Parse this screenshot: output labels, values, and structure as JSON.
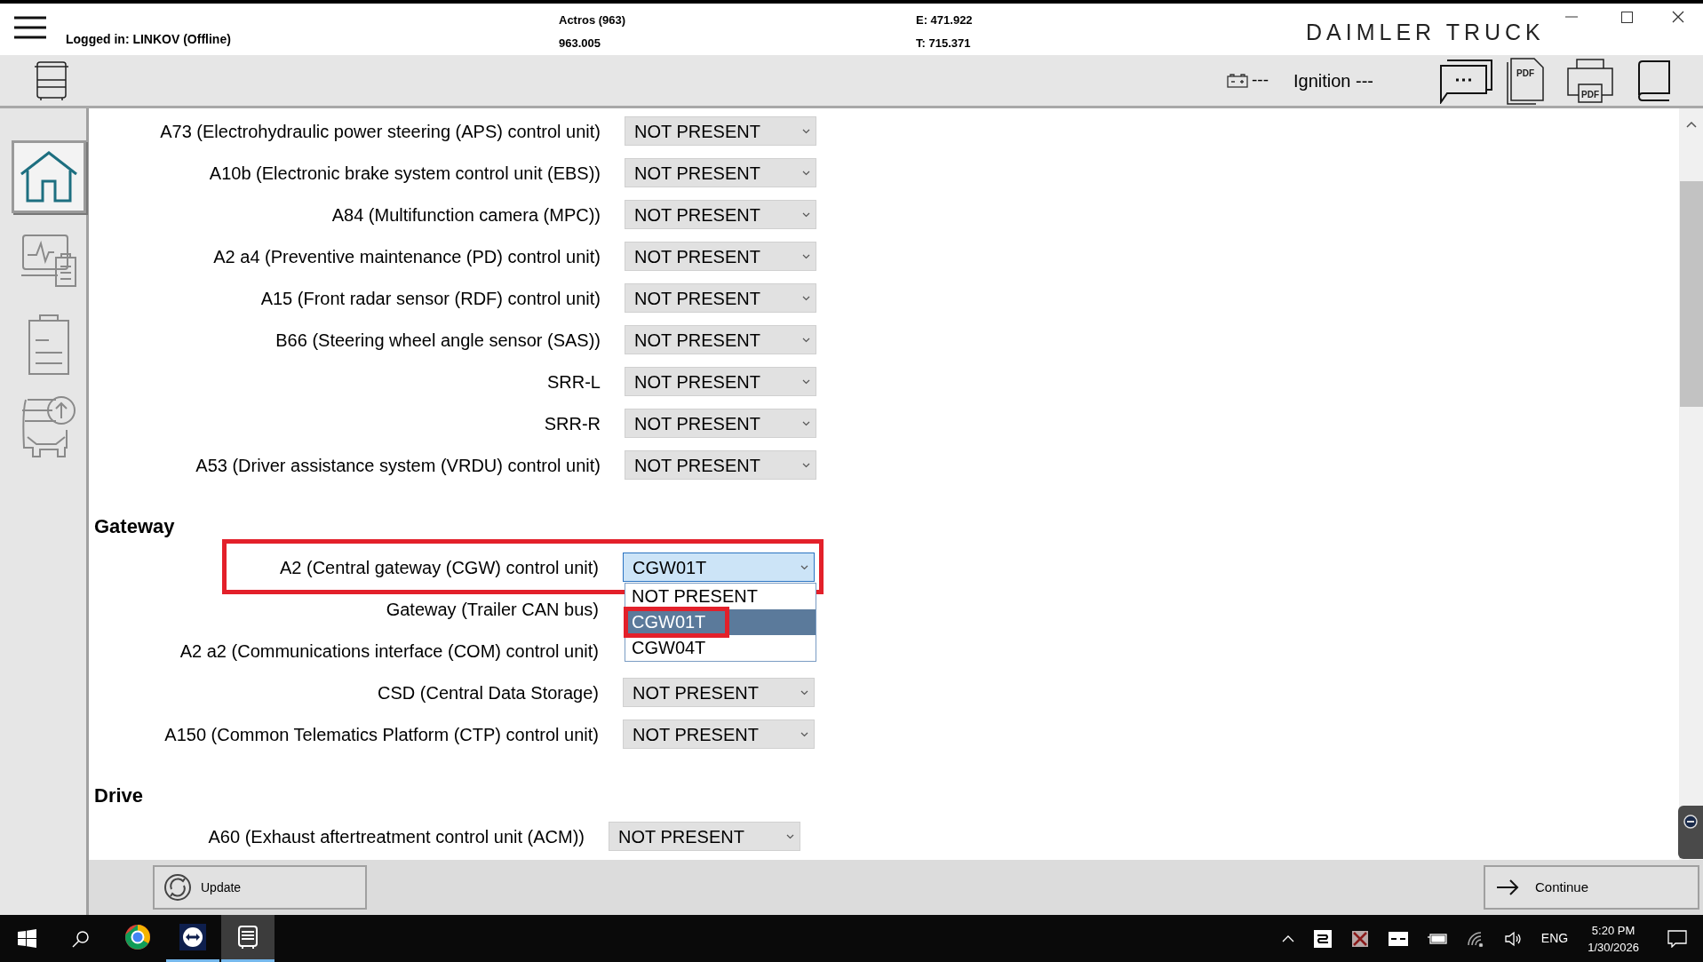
{
  "header": {
    "login": "Logged in: LINKOV (Offline)",
    "vehicle_model": "Actros (963)",
    "vehicle_code": "963.005",
    "e_number": "E: 471.922",
    "t_number": "T: 715.371",
    "brand": "DAIMLER TRUCK"
  },
  "toolbar": {
    "battery_status": "---",
    "ignition": "Ignition ---",
    "pdf_icon_label": "PDF",
    "print_icon_label": "PDF"
  },
  "sidebar": {
    "items": [
      {
        "kind": "home",
        "selected": true
      },
      {
        "kind": "diagnosis",
        "selected": false
      },
      {
        "kind": "checklist",
        "selected": false
      },
      {
        "kind": "truck-update",
        "selected": false
      }
    ]
  },
  "sections": [
    {
      "rows": [
        {
          "label": "A73 (Electrohydraulic power steering (APS) control unit)",
          "value": "NOT PRESENT",
          "highlighted": false
        },
        {
          "label": "A10b (Electronic brake system control unit (EBS))",
          "value": "NOT PRESENT",
          "highlighted": false
        },
        {
          "label": "A84 (Multifunction camera (MPC))",
          "value": "NOT PRESENT",
          "highlighted": false
        },
        {
          "label": "A2 a4 (Preventive maintenance (PD) control unit)",
          "value": "NOT PRESENT",
          "highlighted": false
        },
        {
          "label": "A15 (Front radar sensor (RDF) control unit)",
          "value": "NOT PRESENT",
          "highlighted": false
        },
        {
          "label": "B66 (Steering wheel angle sensor (SAS))",
          "value": "NOT PRESENT",
          "highlighted": false
        },
        {
          "label": "SRR-L",
          "value": "NOT PRESENT",
          "highlighted": false
        },
        {
          "label": "SRR-R",
          "value": "NOT PRESENT",
          "highlighted": false
        },
        {
          "label": "A53 (Driver assistance system (VRDU) control unit)",
          "value": "NOT PRESENT",
          "highlighted": false
        }
      ]
    },
    {
      "title": "Gateway",
      "rows": [
        {
          "label": "A2 (Central gateway (CGW) control unit)",
          "value": "CGW01T",
          "highlighted": true,
          "expanded": true,
          "options": [
            {
              "label": "NOT PRESENT",
              "selected": false,
              "highlighted": false
            },
            {
              "label": "CGW01T",
              "selected": true,
              "highlighted": true
            },
            {
              "label": "CGW04T",
              "selected": false,
              "highlighted": false
            }
          ]
        },
        {
          "label": "Gateway (Trailer CAN bus)",
          "highlighted": false
        },
        {
          "label": "A2 a2 (Communications interface (COM) control unit)",
          "highlighted": false
        },
        {
          "label": "CSD (Central Data Storage)",
          "value": "NOT PRESENT",
          "highlighted": false
        },
        {
          "label": "A150 (Common Telematics Platform (CTP) control unit)",
          "value": "NOT PRESENT",
          "highlighted": false
        }
      ]
    },
    {
      "title": "Drive",
      "rows": [
        {
          "label": "A60 (Exhaust aftertreatment control unit (ACM))",
          "value": "NOT PRESENT",
          "highlighted": false
        }
      ]
    }
  ],
  "buttons": {
    "update": "Update",
    "continue": "Continue"
  },
  "taskbar": {
    "apps": [
      {
        "kind": "chrome",
        "running": false,
        "active": false
      },
      {
        "kind": "teamviewer",
        "running": true,
        "active": false
      },
      {
        "kind": "diagnosis-app",
        "running": true,
        "active": true
      }
    ],
    "language": "ENG",
    "time": "5:20 PM",
    "date": "1/30/2026"
  }
}
